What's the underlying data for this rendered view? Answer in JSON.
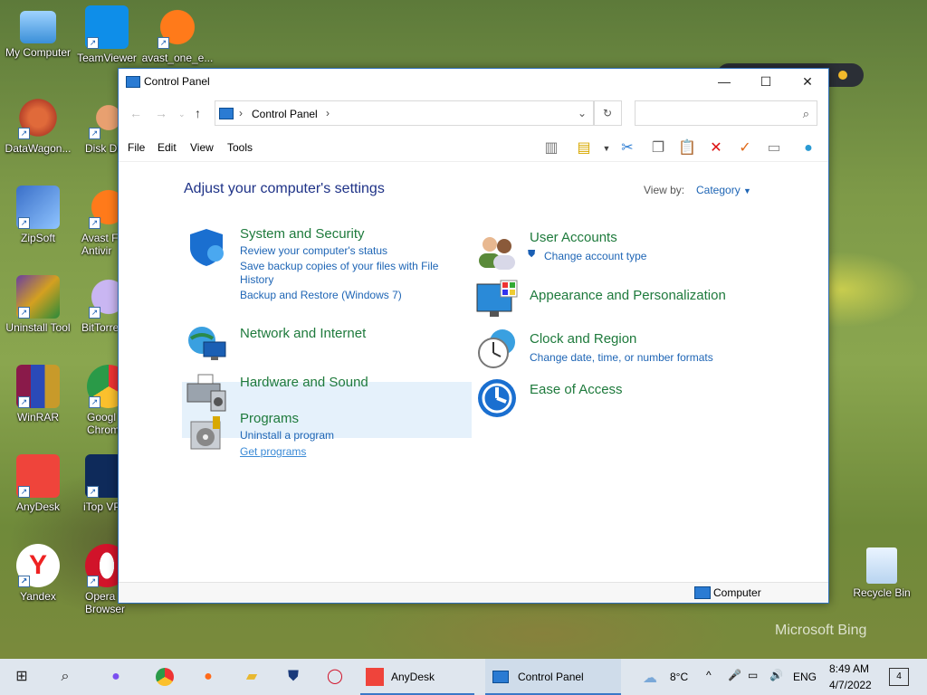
{
  "desktop": {
    "icons_left": [
      {
        "label": "My Computer",
        "lines": [
          "My Computer"
        ]
      },
      {
        "label": "DataWagon...",
        "lines": [
          "DataWagon..."
        ]
      },
      {
        "label": "ZipSoft",
        "lines": [
          "ZipSoft"
        ]
      },
      {
        "label": "Uninstall Tool",
        "lines": [
          "Uninstall Tool"
        ]
      },
      {
        "label": "WinRAR",
        "lines": [
          "WinRAR"
        ]
      },
      {
        "label": "AnyDesk",
        "lines": [
          "AnyDesk"
        ]
      },
      {
        "label": "Yandex",
        "lines": [
          "Yandex"
        ]
      }
    ],
    "icons_second": [
      {
        "l1": "TeamViewer",
        "l2": ""
      },
      {
        "l1": "Disk Dr",
        "l2": ""
      },
      {
        "l1": "Avast F",
        "l2": "Antivir"
      },
      {
        "l1": "BitTorre",
        "l2": ""
      },
      {
        "l1": "Googl",
        "l2": "Chrom"
      },
      {
        "l1": "iTop VP",
        "l2": ""
      },
      {
        "l1": "Opera",
        "l2": "Browser"
      }
    ],
    "icon_avast": "avast_one_e...",
    "icon_recycle": "Recycle Bin",
    "watermark": "Microsoft Bing"
  },
  "window": {
    "title": "Control Panel",
    "address_crumb": "Control Panel",
    "menu": [
      "File",
      "Edit",
      "View",
      "Tools"
    ],
    "heading": "Adjust your computer's settings",
    "view_by_label": "View by:",
    "view_by_value": "Category",
    "status_text": "Computer",
    "categories_left": [
      {
        "title": "System and Security",
        "links": [
          "Review your computer's status",
          "Save backup copies of your files with File",
          "History",
          "Backup and Restore (Windows 7)"
        ]
      },
      {
        "title": "Network and Internet",
        "links": []
      },
      {
        "title": "Hardware and Sound",
        "links": []
      },
      {
        "title": "Programs",
        "links": [
          "Uninstall a program",
          "Get programs"
        ]
      }
    ],
    "categories_right": [
      {
        "title": "User Accounts",
        "links": [
          "Change account type"
        ]
      },
      {
        "title": "Appearance and Personalization",
        "links": []
      },
      {
        "title": "Clock and Region",
        "links": [
          "Change date, time, or number formats"
        ]
      },
      {
        "title": "Ease of Access",
        "links": []
      }
    ]
  },
  "taskbar": {
    "apps": [
      {
        "label": "AnyDesk"
      },
      {
        "label": "Control Panel"
      }
    ],
    "weather": "8°C",
    "language": "ENG",
    "time": "8:49 AM",
    "date": "4/7/2022",
    "notifications": "4"
  },
  "colors": {
    "link": "#1e65b5",
    "category_title": "#1e7a3c",
    "heading": "#1e3287",
    "taskbar": "#dfe6ee"
  }
}
